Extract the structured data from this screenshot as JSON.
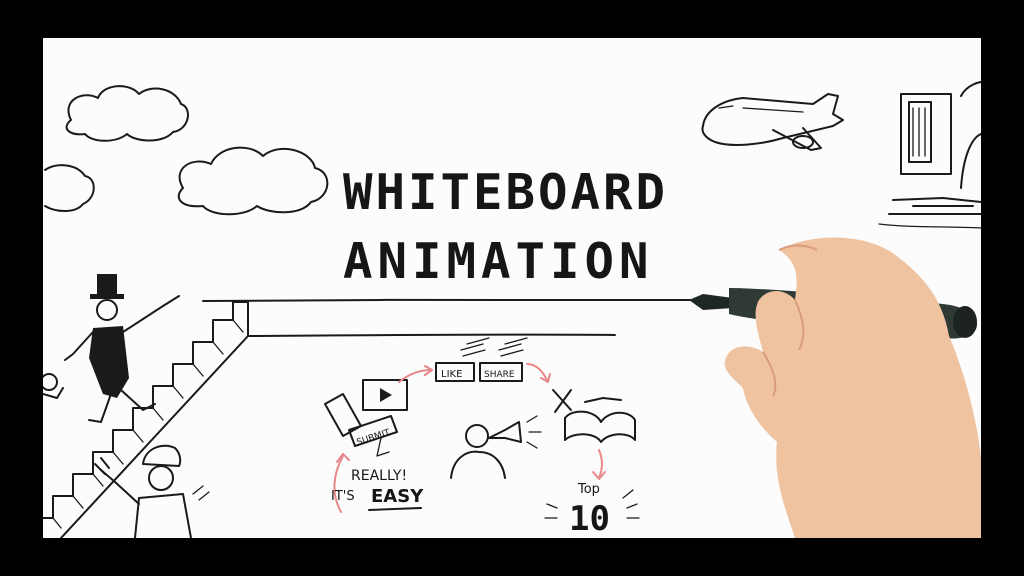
{
  "title": {
    "line1": "WHITEBOARD",
    "line2": "ANIMATION"
  },
  "doodles": {
    "like_label": "LIKE",
    "share_label": "SHARE",
    "submit_label": "SUBMIT",
    "really_label": "REALLY!",
    "its_label": "IT'S",
    "easy_label": "EASY",
    "top_label": "Top",
    "top_number": "10"
  },
  "colors": {
    "frame": "#000000",
    "board": "#fcfcfc",
    "ink": "#1a1a1a",
    "marker_body": "#2f3a34",
    "skin": "#f0c3a0",
    "arrow_accent": "#e8888a"
  }
}
